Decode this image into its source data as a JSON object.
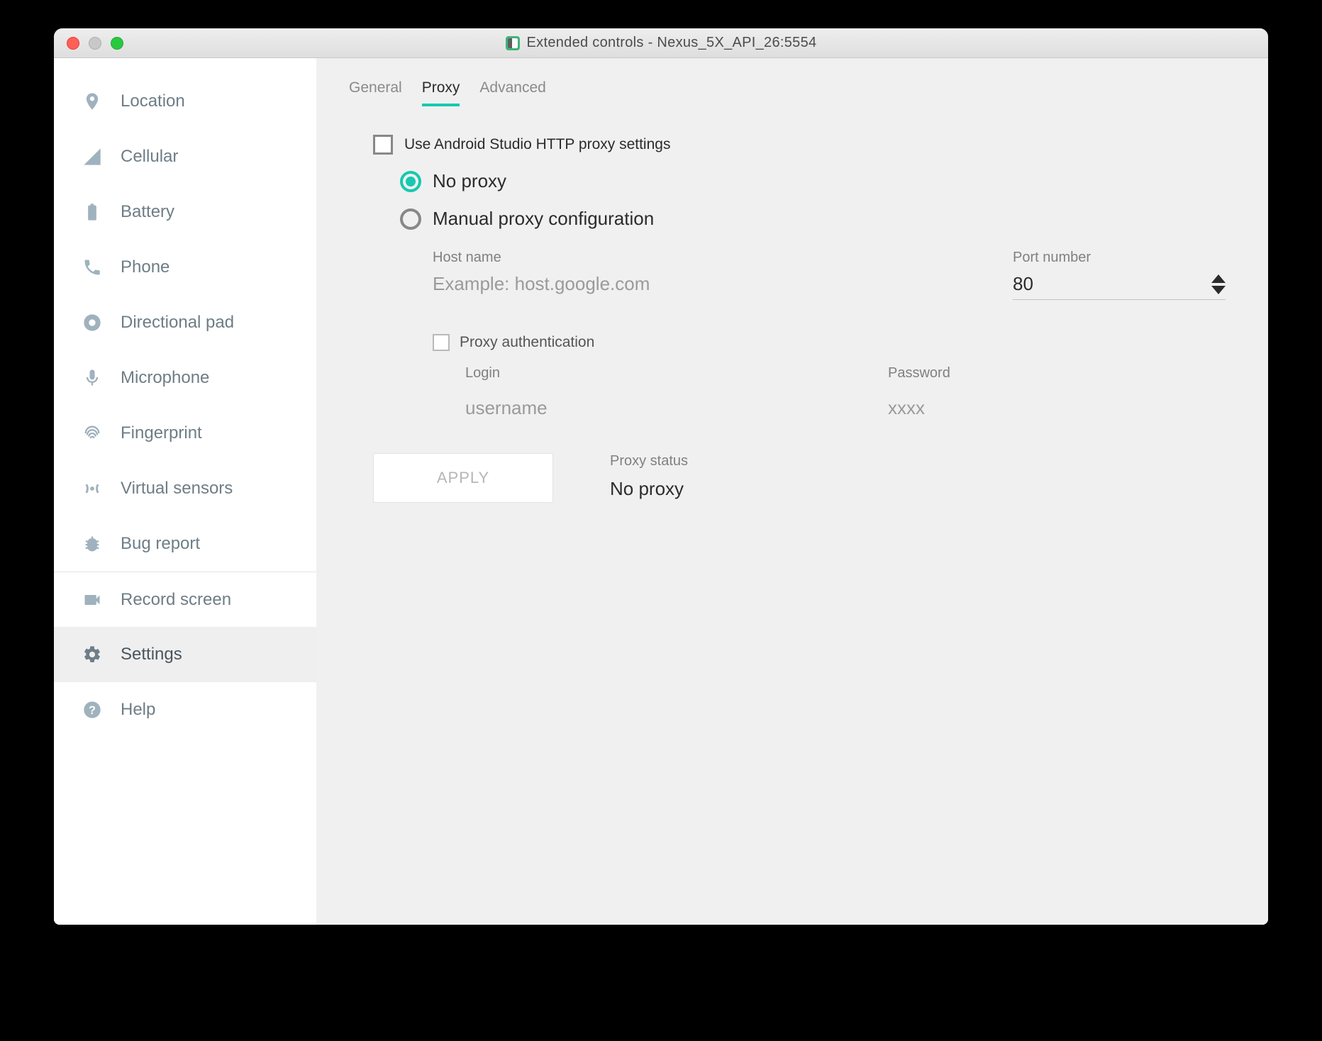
{
  "window": {
    "title": "Extended controls - Nexus_5X_API_26:5554"
  },
  "sidebar": {
    "items": [
      {
        "label": "Location"
      },
      {
        "label": "Cellular"
      },
      {
        "label": "Battery"
      },
      {
        "label": "Phone"
      },
      {
        "label": "Directional pad"
      },
      {
        "label": "Microphone"
      },
      {
        "label": "Fingerprint"
      },
      {
        "label": "Virtual sensors"
      },
      {
        "label": "Bug report"
      },
      {
        "label": "Record screen"
      },
      {
        "label": "Settings"
      },
      {
        "label": "Help"
      }
    ]
  },
  "tabs": {
    "general": "General",
    "proxy": "Proxy",
    "advanced": "Advanced"
  },
  "proxy": {
    "use_as_proxy_label": "Use Android Studio HTTP proxy settings",
    "no_proxy_label": "No proxy",
    "manual_label": "Manual proxy configuration",
    "host_label": "Host name",
    "host_placeholder": "Example: host.google.com",
    "port_label": "Port number",
    "port_value": "80",
    "auth_label": "Proxy authentication",
    "login_label": "Login",
    "login_placeholder": "username",
    "password_label": "Password",
    "password_placeholder": "xxxx",
    "apply_label": "APPLY",
    "status_label": "Proxy status",
    "status_value": "No proxy"
  }
}
